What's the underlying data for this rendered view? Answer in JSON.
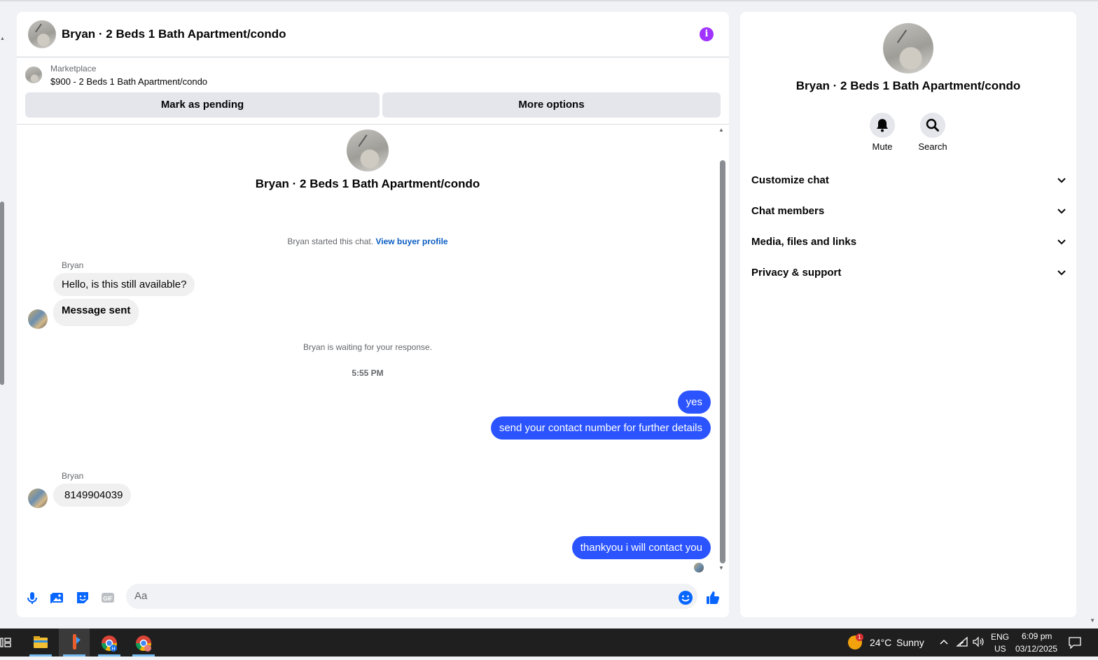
{
  "chat": {
    "title": "Bryan · 2 Beds 1 Bath Apartment/condo",
    "listing": {
      "label": "Marketplace",
      "item": "$900 - 2 Beds 1 Bath Apartment/condo"
    },
    "buttons": {
      "mark_pending": "Mark as pending",
      "more_options": "More options"
    },
    "started_text": "Bryan started this chat.",
    "view_profile": "View buyer profile",
    "waiting_text": "Bryan is waiting for your response.",
    "time": "5:55 PM",
    "messages": {
      "sender": "Bryan",
      "in_1": "Hello, is this still available?",
      "in_2": "Message sent",
      "out_1": "yes",
      "out_2": "send your contact number for further details",
      "in_3": "8149904039",
      "out_3": "thankyou i will contact you"
    },
    "composer_placeholder": "Aa",
    "icons": [
      "microphone-icon",
      "image-icon",
      "sticker-icon",
      "gif-icon",
      "emoji-icon",
      "like-icon",
      "info-icon"
    ],
    "gif_label": "GIF"
  },
  "info_panel": {
    "title": "Bryan · 2 Beds 1 Bath Apartment/condo",
    "actions": {
      "mute": "Mute",
      "search": "Search"
    },
    "sections": {
      "customize": "Customize chat",
      "members": "Chat members",
      "media": "Media, files and links",
      "privacy": "Privacy & support"
    }
  },
  "taskbar": {
    "weather_temp": "24°C",
    "weather_desc": "Sunny",
    "weather_badge": "1",
    "lang_top": "ENG",
    "lang_bottom": "US",
    "time": "6:09 pm",
    "date": "03/12/2025"
  },
  "colors": {
    "accent": "#2b54ff",
    "info_icon": "#a033ff",
    "link": "#0a5dc2",
    "fb_blue": "#0866ff"
  }
}
